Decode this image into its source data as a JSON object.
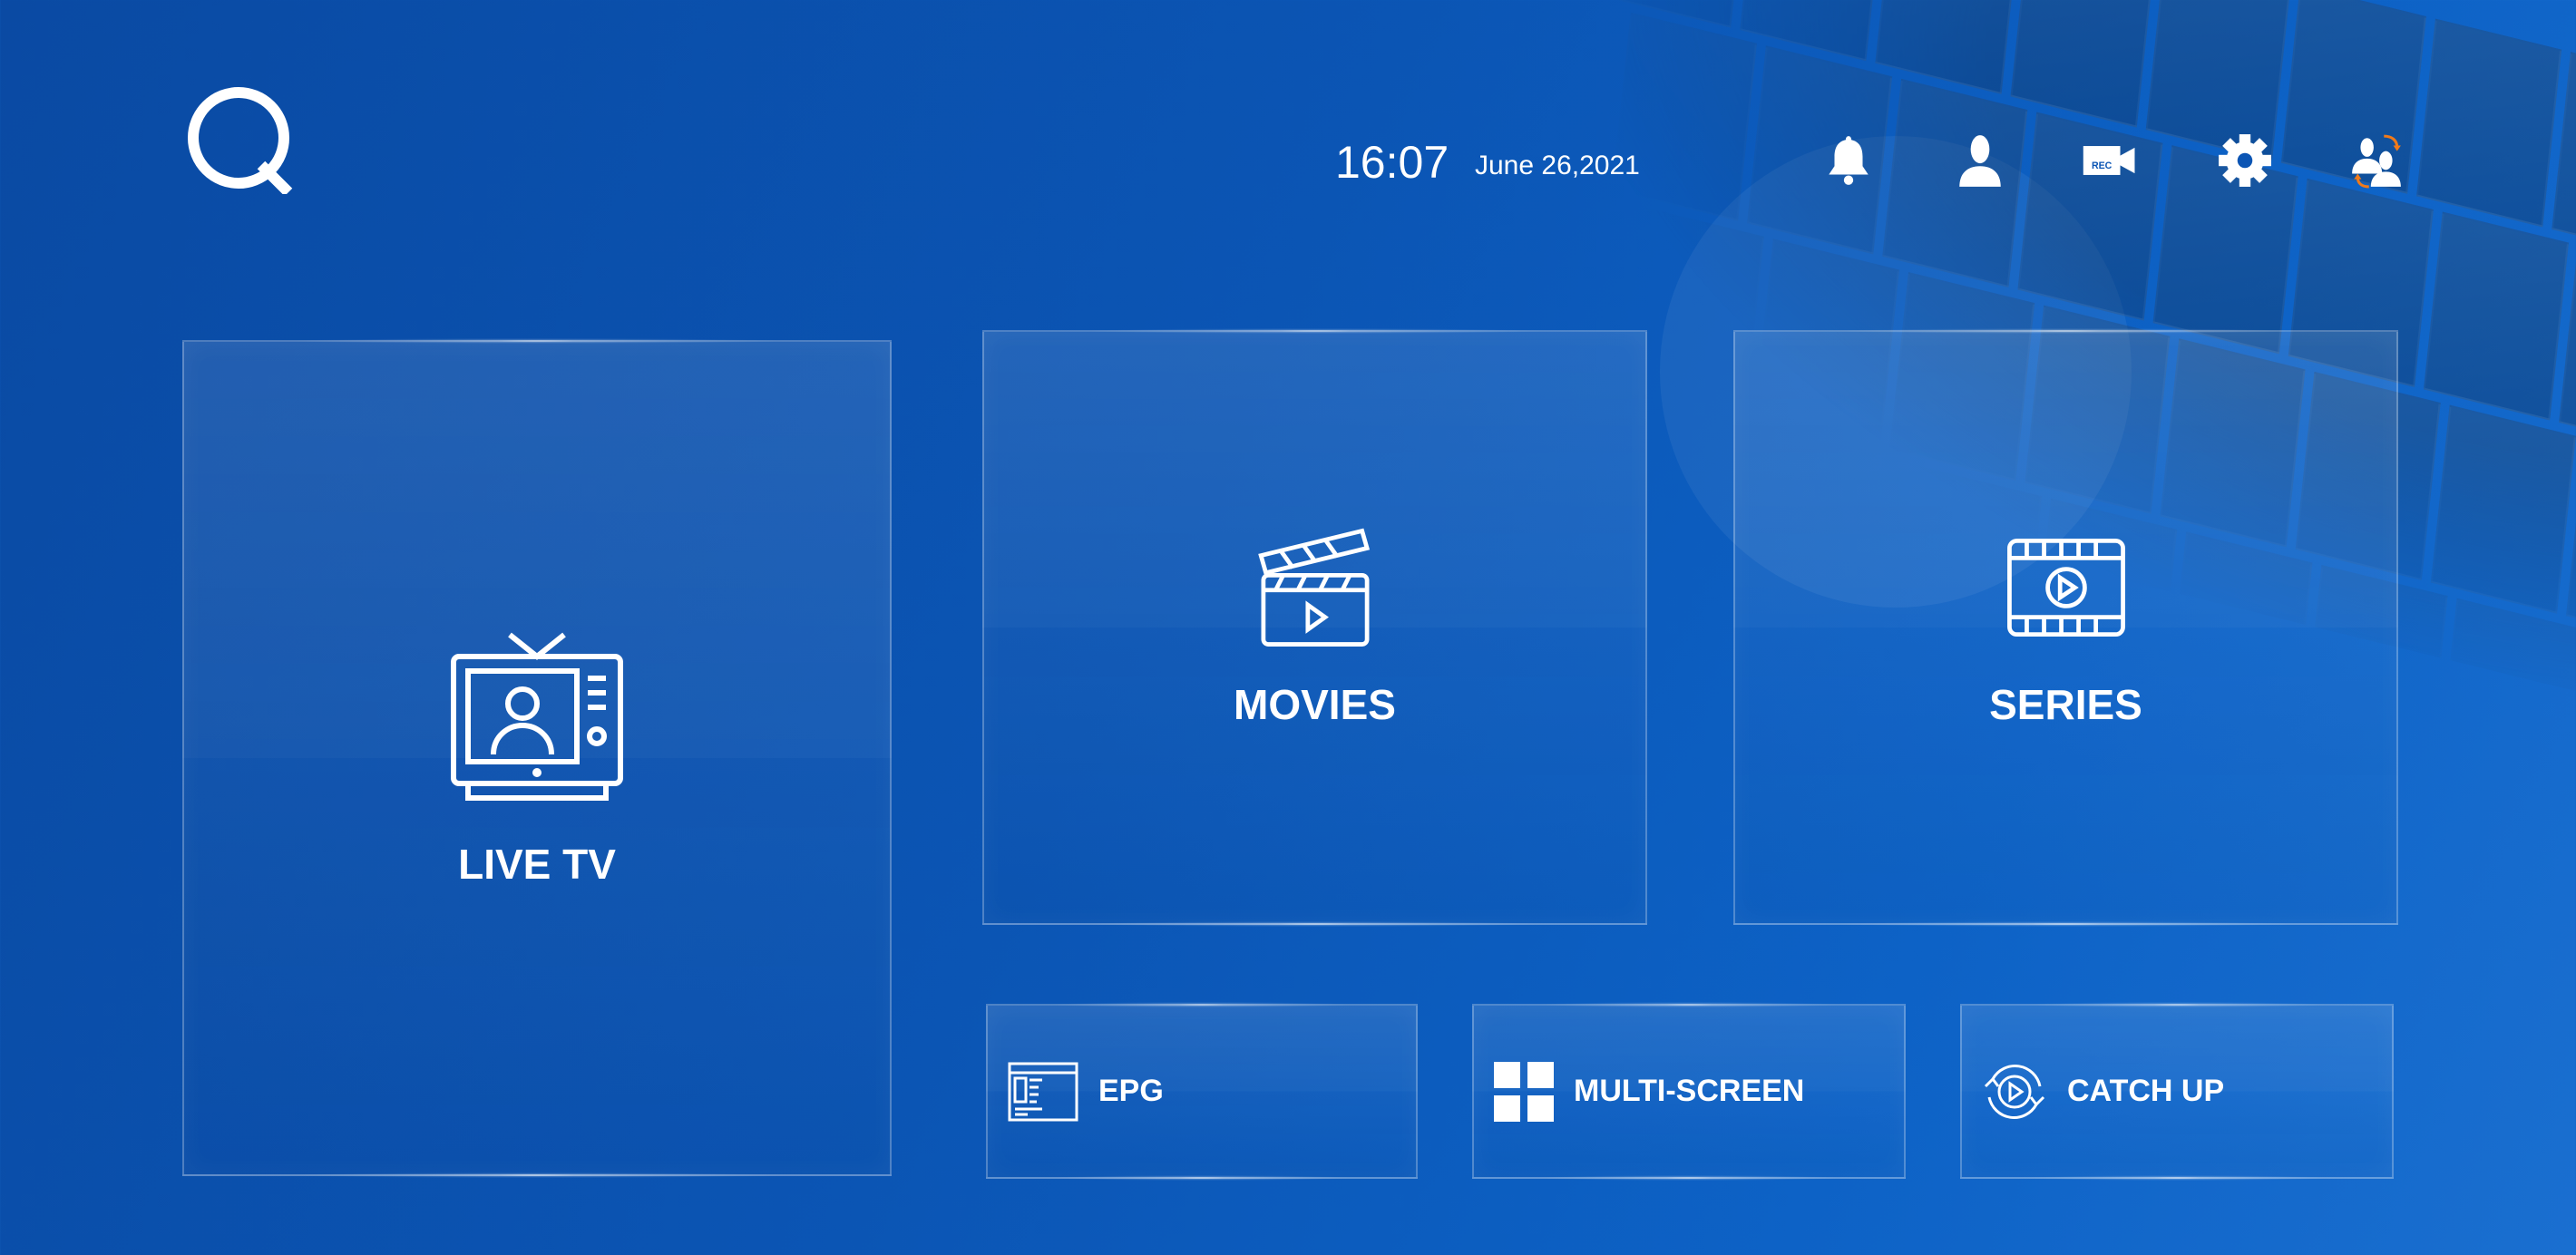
{
  "header": {
    "time": "16:07",
    "date": "June 26,2021",
    "icons": [
      "bell-icon",
      "user-icon",
      "rec-camera-icon",
      "gear-icon",
      "switch-user-icon"
    ],
    "rec_label": "REC"
  },
  "tiles": {
    "live_tv": "LIVE TV",
    "movies": "MOVIES",
    "series": "SERIES",
    "epg": "EPG",
    "multi_screen": "MULTI-SCREEN",
    "catch_up": "CATCH UP"
  },
  "colors": {
    "background": "#0b55b4",
    "accent_arrow": "#f07a1a"
  }
}
